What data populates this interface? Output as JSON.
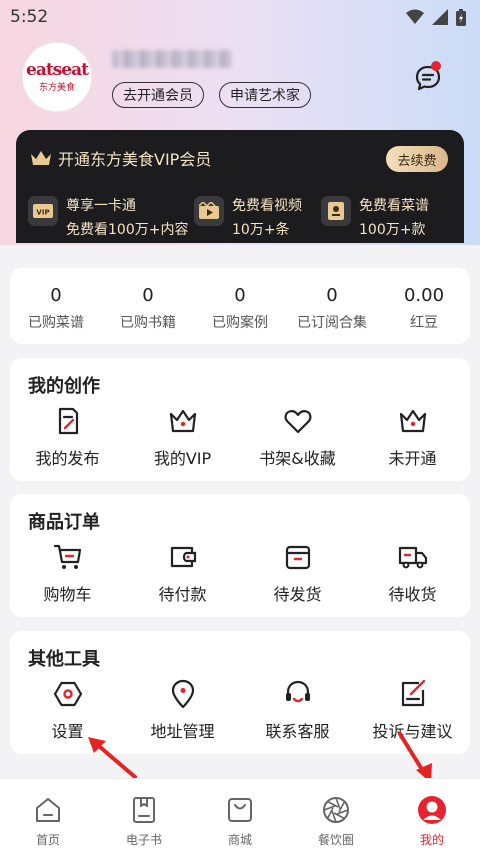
{
  "status_bar": {
    "time": "5:52",
    "icons": [
      "wifi-icon",
      "signal-icon",
      "battery-icon"
    ]
  },
  "profile": {
    "avatar_logo": "eatseat",
    "avatar_sub": "东方美食",
    "username_masked": "·······",
    "vip_pill": "去开通会员",
    "artist_pill": "申请艺术家"
  },
  "vip_card": {
    "title": "开通东方美食VIP会员",
    "renew_label": "去续费",
    "benefits": [
      {
        "icon": "vip-card-icon",
        "line1": "尊享一卡通",
        "line2": "免费看100万+内容"
      },
      {
        "icon": "video-icon",
        "line1": "免费看视频",
        "line2": "10万+条"
      },
      {
        "icon": "recipe-book-icon",
        "line1": "免费看菜谱",
        "line2": "100万+款"
      }
    ]
  },
  "stats": [
    {
      "value": "0",
      "label": "已购菜谱"
    },
    {
      "value": "0",
      "label": "已购书籍"
    },
    {
      "value": "0",
      "label": "已购案例"
    },
    {
      "value": "0",
      "label": "已订阅合集"
    },
    {
      "value": "0.00",
      "label": "红豆"
    }
  ],
  "creation": {
    "title": "我的创作",
    "items": [
      {
        "icon": "publish-icon",
        "label": "我的发布"
      },
      {
        "icon": "crown-icon",
        "label": "我的VIP"
      },
      {
        "icon": "heart-icon",
        "label": "书架&收藏"
      },
      {
        "icon": "crown-icon",
        "label": "未开通"
      }
    ]
  },
  "orders": {
    "title": "商品订单",
    "items": [
      {
        "icon": "cart-icon",
        "label": "购物车"
      },
      {
        "icon": "wallet-icon",
        "label": "待付款"
      },
      {
        "icon": "box-icon",
        "label": "待发货"
      },
      {
        "icon": "truck-icon",
        "label": "待收货"
      }
    ]
  },
  "tools": {
    "title": "其他工具",
    "items": [
      {
        "icon": "settings-icon",
        "label": "设置"
      },
      {
        "icon": "location-icon",
        "label": "地址管理"
      },
      {
        "icon": "headset-icon",
        "label": "联系客服"
      },
      {
        "icon": "feedback-icon",
        "label": "投诉与建议"
      }
    ]
  },
  "tabbar": [
    {
      "icon": "home-icon",
      "label": "首页"
    },
    {
      "icon": "ebook-icon",
      "label": "电子书"
    },
    {
      "icon": "shop-bag-icon",
      "label": "商城"
    },
    {
      "icon": "aperture-icon",
      "label": "餐饮圈"
    },
    {
      "icon": "profile-icon",
      "label": "我的",
      "active": true
    }
  ],
  "colors": {
    "accent": "#e8232f",
    "vip_dark": "#1c1c1e",
    "vip_gold": "#f3e3c3"
  }
}
